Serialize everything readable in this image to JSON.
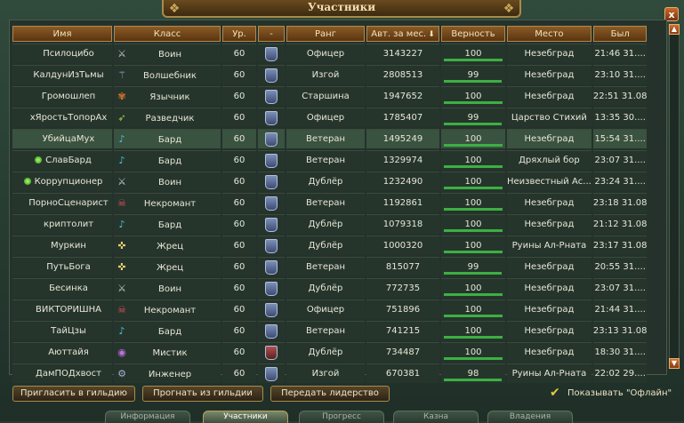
{
  "window": {
    "title": "Участники",
    "close_label": "x"
  },
  "columns": [
    "Имя",
    "Класс",
    "Ур.",
    "-",
    "Ранг",
    "Авт. за мес.",
    "Верность",
    "Место",
    "Был"
  ],
  "sort_indicator": "⬇",
  "rows": [
    {
      "online": false,
      "name": "Псилоцибо",
      "class_icon": "sword-icon",
      "class": "Воин",
      "level": "60",
      "guild_icon": "blue",
      "rank": "Офицер",
      "auth": "3143227",
      "loyalty": "100",
      "place": "Незебград",
      "seen": "21:46 31...."
    },
    {
      "online": false,
      "name": "КалдунИзТьмы",
      "class_icon": "staff-icon",
      "class": "Волшебник",
      "level": "60",
      "guild_icon": "blue",
      "rank": "Изгой",
      "auth": "2808513",
      "loyalty": "99",
      "place": "Незебград",
      "seen": "23:10 31...."
    },
    {
      "online": false,
      "name": "Громошлеп",
      "class_icon": "paw-icon",
      "class": "Язычник",
      "level": "60",
      "guild_icon": "blue",
      "rank": "Старшина",
      "auth": "1947652",
      "loyalty": "100",
      "place": "Незебград",
      "seen": "22:51 31.08"
    },
    {
      "online": false,
      "name": "хЯростьТопорАх",
      "class_icon": "bow-icon",
      "class": "Разведчик",
      "level": "60",
      "guild_icon": "blue",
      "rank": "Офицер",
      "auth": "1785407",
      "loyalty": "99",
      "place": "Царство Стихий",
      "seen": "13:35 30...."
    },
    {
      "online": false,
      "name": "УбийцаМух",
      "class_icon": "lute-icon",
      "class": "Бард",
      "level": "60",
      "guild_icon": "blue",
      "rank": "Ветеран",
      "auth": "1495249",
      "loyalty": "100",
      "place": "Незебград",
      "seen": "15:54 31...."
    },
    {
      "online": true,
      "name": "СлавБард",
      "class_icon": "lute-icon",
      "class": "Бард",
      "level": "60",
      "guild_icon": "blue",
      "rank": "Ветеран",
      "auth": "1329974",
      "loyalty": "100",
      "place": "Дряхлый бор",
      "seen": "23:07 31...."
    },
    {
      "online": true,
      "name": "Коррупционер",
      "class_icon": "sword-icon",
      "class": "Воин",
      "level": "60",
      "guild_icon": "blue",
      "rank": "Дублёр",
      "auth": "1232490",
      "loyalty": "100",
      "place": "Неизвестный Ас...",
      "seen": "23:24 31...."
    },
    {
      "online": false,
      "name": "ПорноСценарист",
      "class_icon": "skull-icon",
      "class": "Некромант",
      "level": "60",
      "guild_icon": "blue",
      "rank": "Ветеран",
      "auth": "1192861",
      "loyalty": "100",
      "place": "Незебград",
      "seen": "23:18 31.08"
    },
    {
      "online": false,
      "name": "криптолит",
      "class_icon": "lute-icon",
      "class": "Бард",
      "level": "60",
      "guild_icon": "blue",
      "rank": "Дублёр",
      "auth": "1079318",
      "loyalty": "100",
      "place": "Незебград",
      "seen": "21:12 31.08"
    },
    {
      "online": false,
      "name": "Муркин",
      "class_icon": "holy-icon",
      "class": "Жрец",
      "level": "60",
      "guild_icon": "blue",
      "rank": "Дублёр",
      "auth": "1000320",
      "loyalty": "100",
      "place": "Руины Ал-Рната",
      "seen": "23:17 31.08"
    },
    {
      "online": false,
      "name": "ПутьБога",
      "class_icon": "holy-icon",
      "class": "Жрец",
      "level": "60",
      "guild_icon": "blue",
      "rank": "Ветеран",
      "auth": "815077",
      "loyalty": "99",
      "place": "Незебград",
      "seen": "20:55 31...."
    },
    {
      "online": false,
      "name": "Бесинка",
      "class_icon": "sword-icon",
      "class": "Воин",
      "level": "60",
      "guild_icon": "blue",
      "rank": "Дублёр",
      "auth": "772735",
      "loyalty": "100",
      "place": "Незебград",
      "seen": "23:07 31...."
    },
    {
      "online": false,
      "name": "ВИКТОРИШНА",
      "class_icon": "skull-icon",
      "class": "Некромант",
      "level": "60",
      "guild_icon": "blue",
      "rank": "Офицер",
      "auth": "751896",
      "loyalty": "100",
      "place": "Незебград",
      "seen": "21:44 31...."
    },
    {
      "online": false,
      "name": "ТайЦзы",
      "class_icon": "lute-icon",
      "class": "Бард",
      "level": "60",
      "guild_icon": "blue",
      "rank": "Ветеран",
      "auth": "741215",
      "loyalty": "100",
      "place": "Незебград",
      "seen": "23:13 31.08"
    },
    {
      "online": false,
      "name": "Аюттайя",
      "class_icon": "mystic-icon",
      "class": "Мистик",
      "level": "60",
      "guild_icon": "red",
      "rank": "Дублёр",
      "auth": "734487",
      "loyalty": "100",
      "place": "Незебград",
      "seen": "18:30 31...."
    },
    {
      "online": false,
      "name": "ДамПОДхвост",
      "class_icon": "gear-icon",
      "class": "Инженер",
      "level": "60",
      "guild_icon": "blue",
      "rank": "Изгой",
      "auth": "670381",
      "loyalty": "98",
      "place": "Руины Ал-Рната",
      "seen": "22:02 29...."
    }
  ],
  "selected_rows": [
    4
  ],
  "buttons": {
    "invite": "Пригласить в гильдию",
    "kick": "Прогнать из гильдии",
    "leader": "Передать лидерство"
  },
  "show_offline": {
    "label": "Показывать \"Офлайн\"",
    "checked": true
  },
  "tabs": [
    "Информация",
    "Участники",
    "Прогресс",
    "Казна",
    "Владения"
  ],
  "active_tab": 1,
  "colors": {
    "accent": "#a88b4a",
    "loyalty_bar": "#3cb043",
    "online_dot": "#7ee04a"
  }
}
